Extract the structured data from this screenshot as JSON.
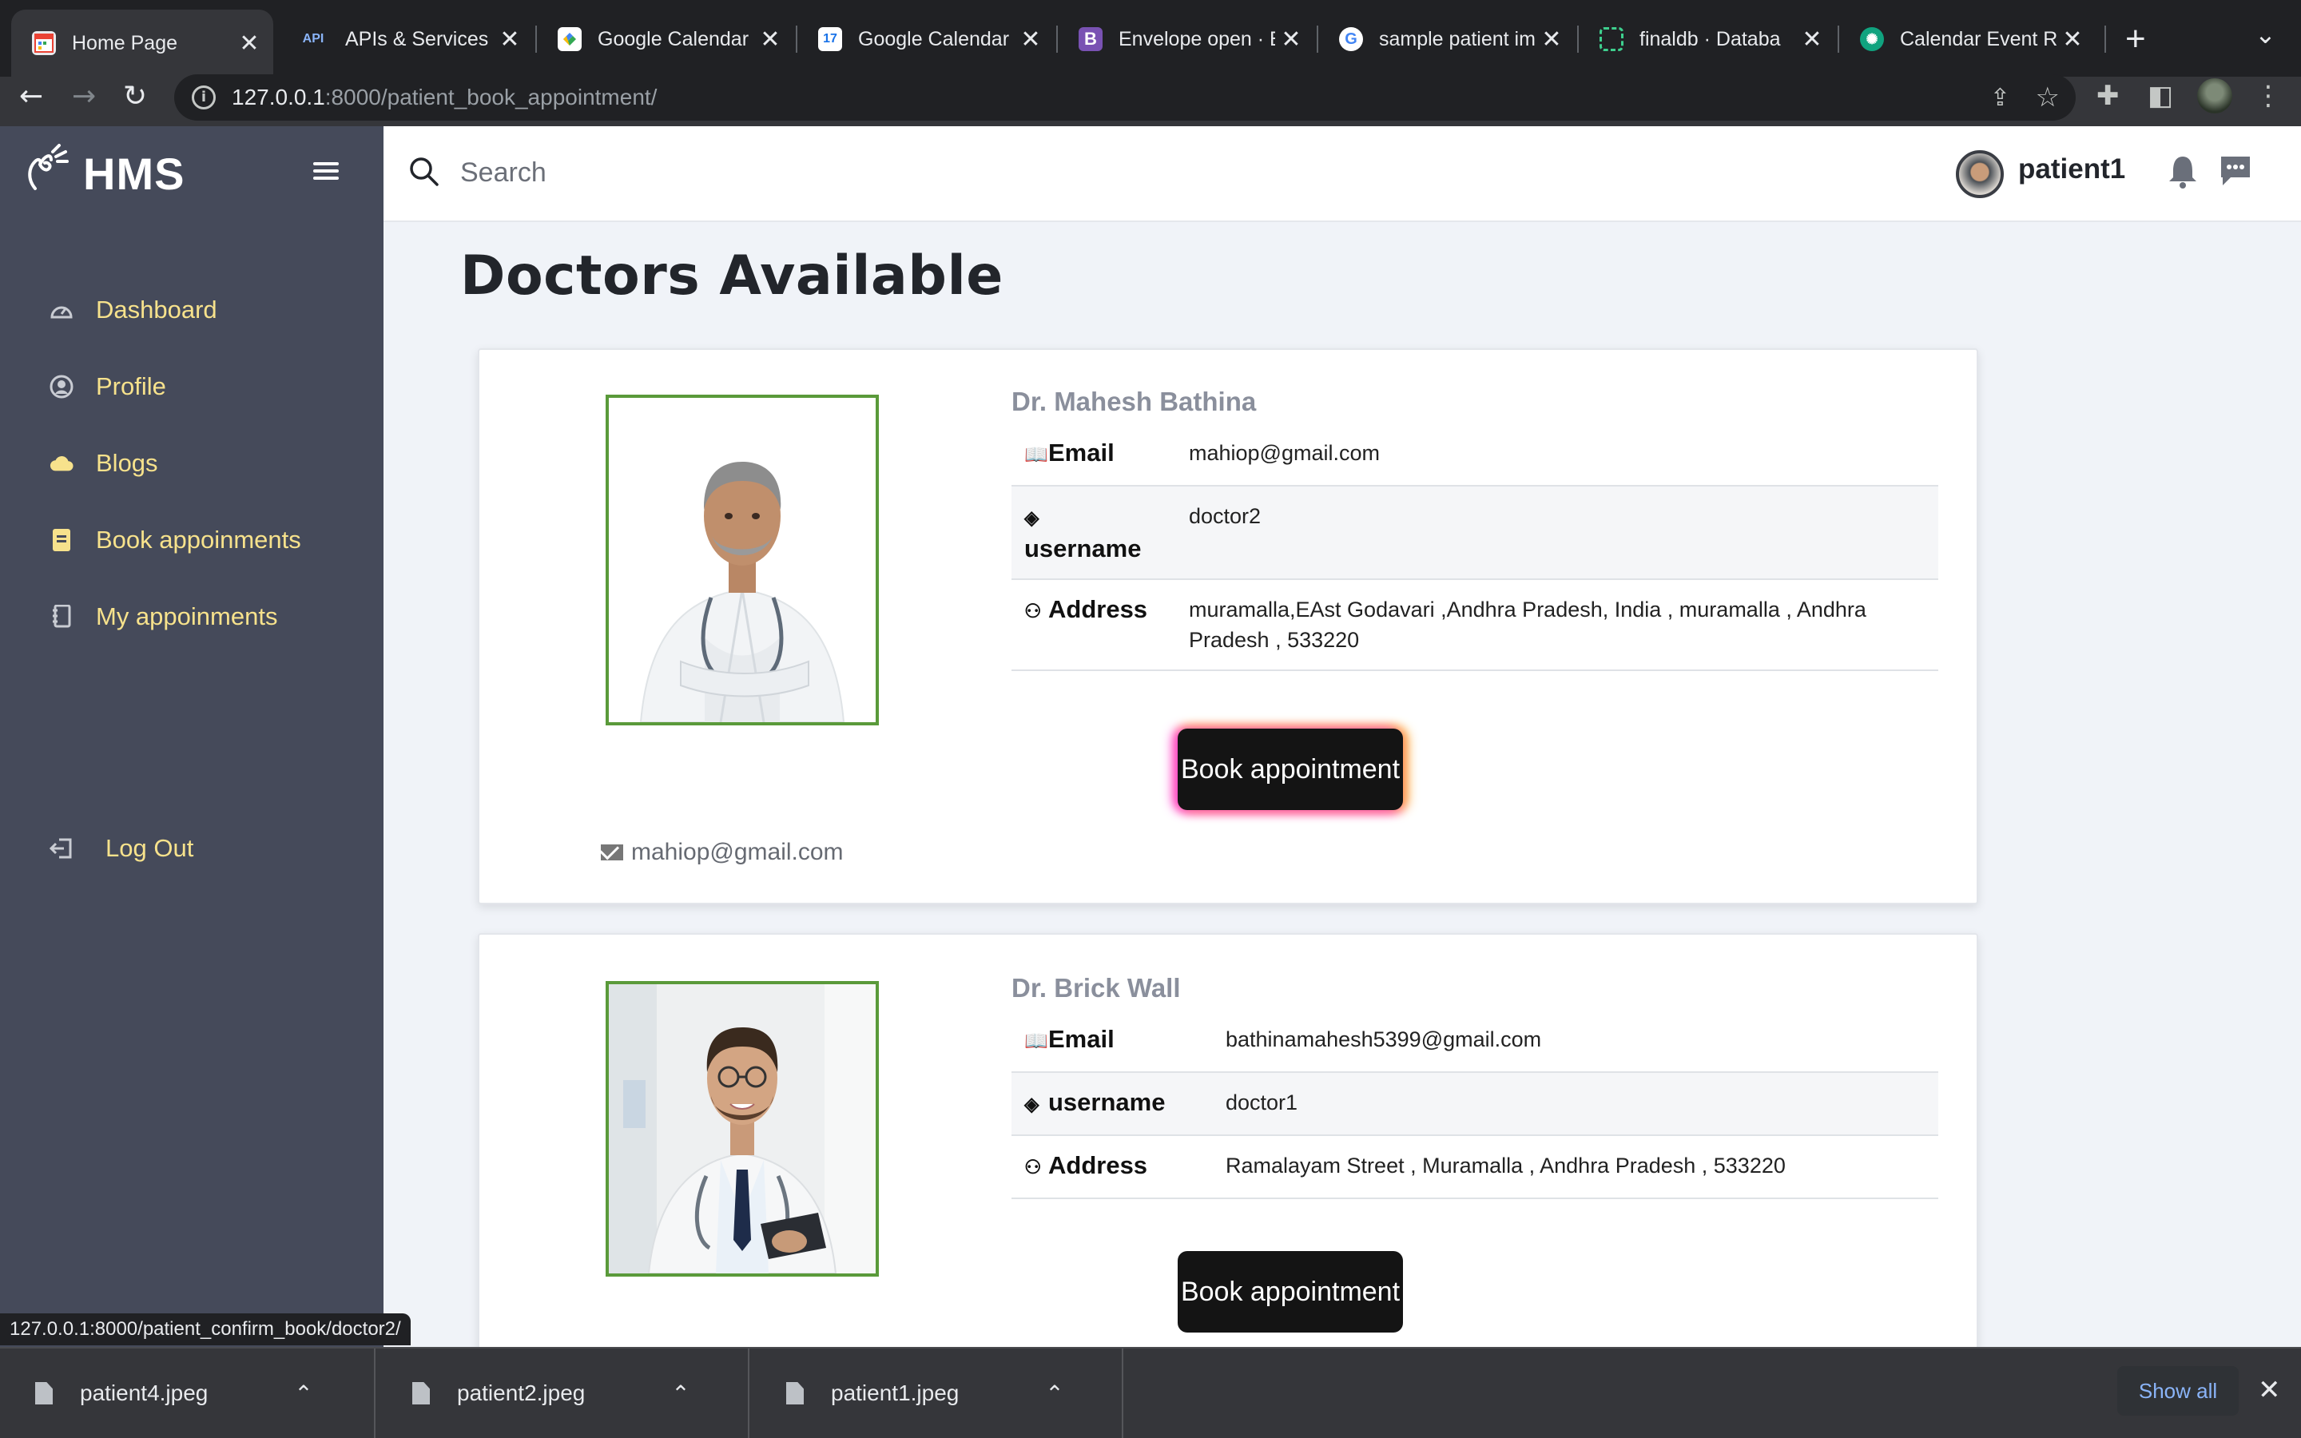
{
  "browser": {
    "tabs": [
      {
        "title": "Home Page",
        "favicon": "calendar-grid-icon",
        "color": "#ea4335"
      },
      {
        "title": "APIs & Services –",
        "favicon": "api-icon",
        "color": "#8ab4f8"
      },
      {
        "title": "Google Calendar",
        "favicon": "google-apps-icon",
        "color": "#fbbc05"
      },
      {
        "title": "Google Calendar",
        "favicon": "calendar-17-icon",
        "color": "#4285f4"
      },
      {
        "title": "Envelope open · B",
        "favicon": "bootstrap-icon",
        "color": "#7952b3"
      },
      {
        "title": "sample patient im",
        "favicon": "google-icon",
        "color": "#ffffff"
      },
      {
        "title": "finaldb · Databa",
        "favicon": "database-icon",
        "color": "#3ecf8e"
      },
      {
        "title": "Calendar Event R",
        "favicon": "openai-icon",
        "color": "#10a37f"
      }
    ],
    "url_host": "127.0.0.1",
    "url_rest": ":8000/patient_book_appointment/",
    "status_url": "127.0.0.1:8000/patient_confirm_book/doctor2/"
  },
  "sidebar": {
    "brand": "HMS",
    "items": [
      {
        "label": "Dashboard",
        "icon": "gauge-icon"
      },
      {
        "label": "Profile",
        "icon": "user-circle-icon"
      },
      {
        "label": "Blogs",
        "icon": "cloud-icon"
      },
      {
        "label": "Book appoinments",
        "icon": "clipboard-icon"
      },
      {
        "label": "My appoinments",
        "icon": "notebook-icon"
      }
    ],
    "logout": "Log Out"
  },
  "topbar": {
    "search_placeholder": "Search",
    "username": "patient1"
  },
  "main": {
    "heading": "Doctors Available",
    "doctors": [
      {
        "name": "Dr. Mahesh Bathina",
        "email_label": "Email",
        "email": "mahiop@gmail.com",
        "username_label": "username",
        "username": "doctor2",
        "address_label": "Address",
        "address": "muramalla,EAst Godavari ,Andhra Pradesh, India , muramalla , Andhra Pradesh , 533220",
        "button": "Book appointment",
        "footer_email": "mahiop@gmail.com"
      },
      {
        "name": "Dr. Brick Wall",
        "email_label": "Email",
        "email": "bathinamahesh5399@gmail.com",
        "username_label": "username",
        "username": "doctor1",
        "address_label": "Address",
        "address": "Ramalayam Street , Muramalla , Andhra Pradesh , 533220",
        "button": "Book appointment"
      }
    ]
  },
  "downloads": {
    "files": [
      "patient4.jpeg",
      "patient2.jpeg",
      "patient1.jpeg"
    ],
    "show_all": "Show all"
  },
  "colors": {
    "sidebar_bg": "#454a5a",
    "nav_text": "#f7e28c",
    "photo_border": "#5a9a3a",
    "button_bg": "#141414"
  }
}
